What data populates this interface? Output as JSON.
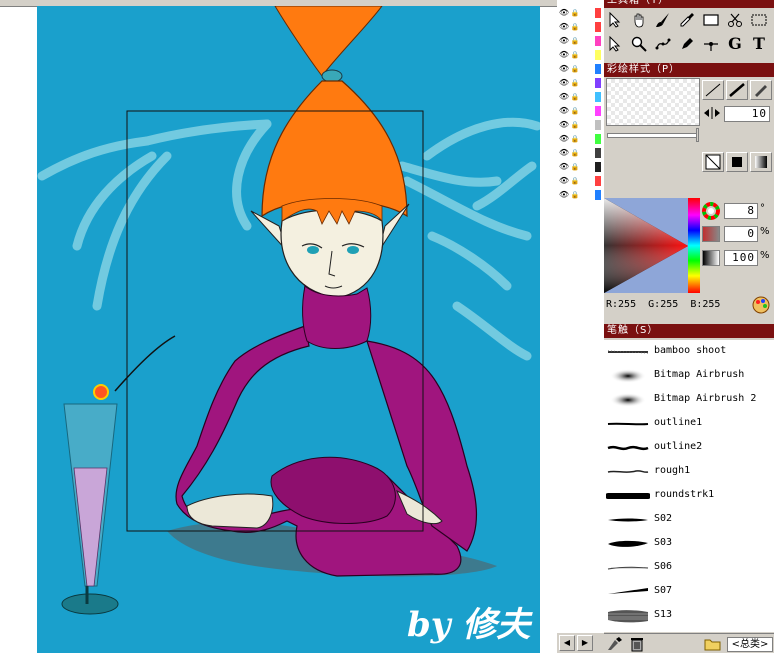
{
  "panels": {
    "tools_title": "工具箱（T）",
    "stroke_title": "彩绘样式（P）",
    "brush_title": "笔触（S）"
  },
  "stroke": {
    "size": "10",
    "angle": "8",
    "value_a": "0",
    "value_b": "100",
    "unit_degree": "°",
    "unit_percent": "%"
  },
  "color": {
    "r_label": "R:255",
    "g_label": "G:255",
    "b_label": "B:255",
    "current": "#ffffff"
  },
  "brushes": [
    {
      "name": "bamboo shoot"
    },
    {
      "name": "Bitmap Airbrush"
    },
    {
      "name": "Bitmap Airbrush 2"
    },
    {
      "name": "outline1"
    },
    {
      "name": "outline2"
    },
    {
      "name": "rough1"
    },
    {
      "name": "roundstrk1"
    },
    {
      "name": "S02"
    },
    {
      "name": "S03"
    },
    {
      "name": "S06"
    },
    {
      "name": "S07"
    },
    {
      "name": "S13"
    }
  ],
  "brush_footer": {
    "category_select": "<总类>"
  },
  "layers": [
    {
      "color": "#ff4040"
    },
    {
      "color": "#ff4040"
    },
    {
      "color": "#ff40c0"
    },
    {
      "color": "#ffff60"
    },
    {
      "color": "#2080ff"
    },
    {
      "color": "#8040ff"
    },
    {
      "color": "#40c0ff"
    },
    {
      "color": "#ff40ff"
    },
    {
      "color": "#c0c0c0"
    },
    {
      "color": "#40ff40"
    },
    {
      "color": "#404040"
    },
    {
      "color": "#202020"
    },
    {
      "color": "#ff4040"
    },
    {
      "color": "#2080ff"
    }
  ],
  "artwork": {
    "signature": "by 修夫",
    "palette": {
      "background": "#1aa0cc",
      "sweater": "#a0157e",
      "hair": "#ff7a10",
      "skin": "#f4f0e0"
    }
  }
}
